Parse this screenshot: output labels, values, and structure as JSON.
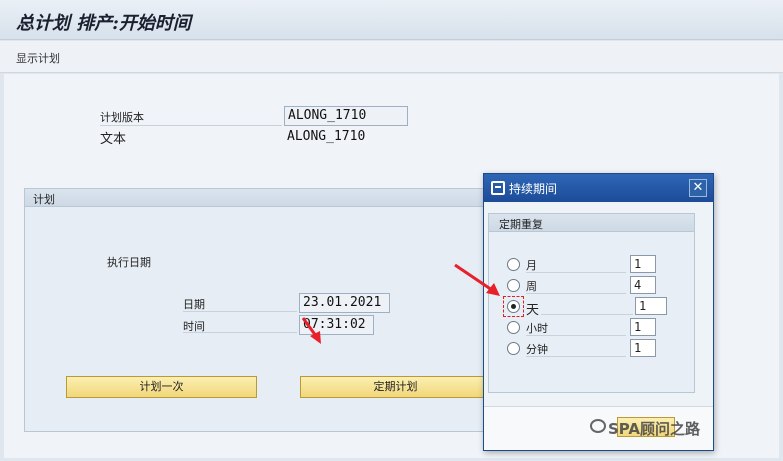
{
  "title": "总计划 排产:开始时间",
  "toolbar": {
    "item": "显示计划"
  },
  "header": {
    "plan_version_label": "计划版本",
    "plan_version_value": "ALONG_1710",
    "text_label": "文本",
    "text_value": "ALONG_1710"
  },
  "plan_group": {
    "title": "计划",
    "exec_date_label": "执行日期",
    "date_label": "日期",
    "date_value": "23.01.2021",
    "time_label": "时间",
    "time_value": "07:31:02",
    "btn_once": "计划一次",
    "btn_periodic": "定期计划"
  },
  "dialog": {
    "title": "持续期间",
    "close": "✕",
    "group_title": "定期重复",
    "options": [
      {
        "label": "月",
        "value": "1",
        "checked": false
      },
      {
        "label": "周",
        "value": "4",
        "checked": false
      },
      {
        "label": "天",
        "value": "1",
        "checked": true
      },
      {
        "label": "小时",
        "value": "1",
        "checked": false
      },
      {
        "label": "分钟",
        "value": "1",
        "checked": false
      }
    ]
  },
  "watermark": "SPA顾问之路",
  "colors": {
    "accent": "#1c4c98",
    "button": "#f2d77a",
    "arrow": "#e8202a"
  }
}
